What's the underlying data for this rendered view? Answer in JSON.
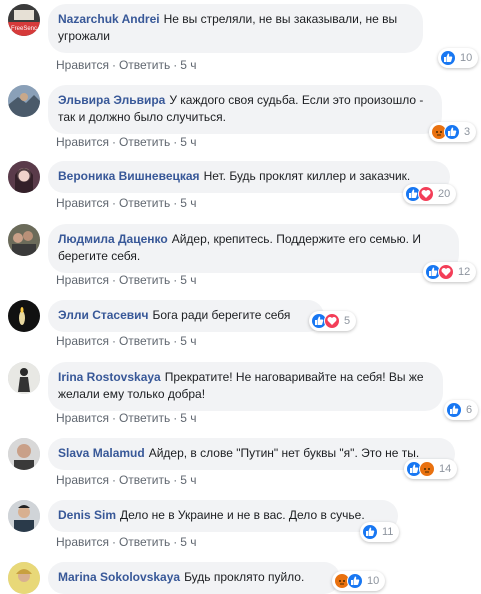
{
  "actions": {
    "like": "Нравится",
    "reply": "Ответить",
    "sep": "·"
  },
  "comments": [
    {
      "author": "Nazarchuk Andrei",
      "text": "Не вы стреляли, не вы заказывали, не вы угрожали",
      "time": "5 ч",
      "count": "10",
      "reactions": [
        "like"
      ]
    },
    {
      "author": "Эльвира Эльвира",
      "text": "У каждого своя судьба. Если это произошло - так и должно было случиться.",
      "time": "5 ч",
      "count": "3",
      "reactions": [
        "angry",
        "like"
      ]
    },
    {
      "author": "Вероника Вишневецкая",
      "text": "Нет. Будь проклят киллер и заказчик.",
      "time": "5 ч",
      "count": "20",
      "reactions": [
        "like",
        "love"
      ]
    },
    {
      "author": "Людмила Даценко",
      "text": "Айдер, крепитесь. Поддержите его семью. И берегите себя.",
      "time": "5 ч",
      "count": "12",
      "reactions": [
        "like",
        "love"
      ]
    },
    {
      "author": "Элли Стасевич",
      "text": "Бога ради берегите себя",
      "time": "5 ч",
      "count": "5",
      "reactions": [
        "like",
        "love"
      ]
    },
    {
      "author": "Irina Rostovskaya",
      "text": "Прекратите! Не наговаривайте на себя! Вы же желали ему только добра!",
      "time": "5 ч",
      "count": "6",
      "reactions": [
        "like"
      ]
    },
    {
      "author": "Slava Malamud",
      "text": "Айдер, в слове \"Путин\" нет буквы \"я\". Это не ты.",
      "time": "5 ч",
      "count": "14",
      "reactions": [
        "like",
        "angry"
      ]
    },
    {
      "author": "Denis Sim",
      "text": "Дело не в Украине и не в вас. Дело в сучье.",
      "time": "5 ч",
      "count": "11",
      "reactions": [
        "like"
      ]
    },
    {
      "author": "Marina Sokolovskaya",
      "text": "Будь проклято пуйло.",
      "time": "",
      "count": "10",
      "reactions": [
        "angry",
        "like"
      ]
    }
  ],
  "colors": {
    "link": "#385898",
    "like": "#1877f2",
    "love": "#f33e58",
    "angry": "#e9710f",
    "bubble": "#f2f3f5"
  }
}
